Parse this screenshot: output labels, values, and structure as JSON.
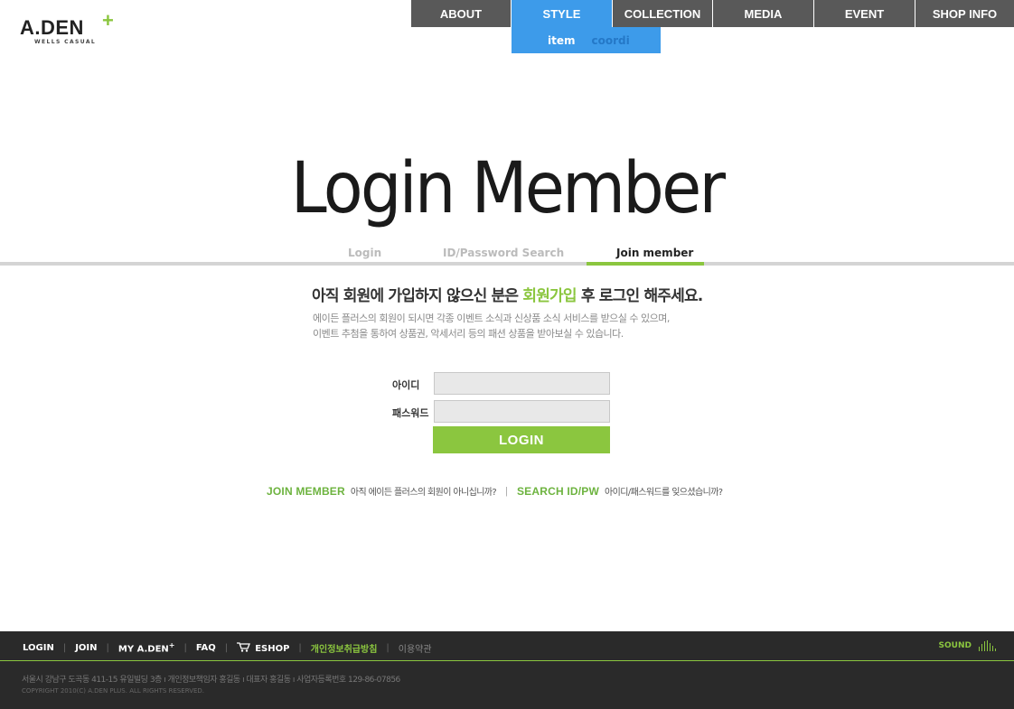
{
  "logo": {
    "main": "A.DEN",
    "plus": "+",
    "sub": "WELLS CASUAL"
  },
  "nav": {
    "items": [
      {
        "label": "ABOUT",
        "active": false
      },
      {
        "label": "STYLE",
        "active": true
      },
      {
        "label": "COLLECTION",
        "active": false
      },
      {
        "label": "MEDIA",
        "active": false
      },
      {
        "label": "EVENT",
        "active": false
      },
      {
        "label": "SHOP INFO",
        "active": false
      }
    ],
    "sub_items": [
      {
        "label": "item",
        "active": true
      },
      {
        "label": "coordi",
        "active": false
      }
    ]
  },
  "page_title": "Login Member",
  "tabs": [
    {
      "label": "Login",
      "active": false
    },
    {
      "label": "ID/Password Search",
      "active": false
    },
    {
      "label": "Join member",
      "active": true
    }
  ],
  "intro": {
    "heading_pre": "아직 회원에 가입하지 않으신 분은 ",
    "heading_highlight": "회원가입",
    "heading_post": " 후 로그인 해주세요.",
    "desc_line1": "에이든 플러스의 회원이 되시면 각종 이벤트 소식과 신상품 소식 서비스를 받으실 수 있으며,",
    "desc_line2": "이벤트 추첨을 통하여 상품권, 악세서리 등의 패션 상품을 받아보실 수 있습니다."
  },
  "form": {
    "id_label": "아이디",
    "id_value": "",
    "pw_label": "패스워드",
    "pw_value": "",
    "login_button": "LOGIN"
  },
  "links": {
    "join_label": "JOIN MEMBER",
    "join_desc": "아직 에이든 플러스의 회원이 아니십니까?",
    "search_label": "SEARCH ID/PW",
    "search_desc": "아이디/패스워드를 잊으셨습니까?"
  },
  "footer": {
    "menu": {
      "login": "LOGIN",
      "join": "JOIN",
      "my": "MY A.DEN",
      "my_plus": "+",
      "faq": "FAQ",
      "eshop": "ESHOP",
      "privacy": "개인정보취급방침",
      "terms": "이용약관"
    },
    "sound_label": "SOUND",
    "address": "서울시 강남구 도곡동 411-15 유일빌딩 3층  ı  개인정보책임자 홍길동  ı  대표자 홍길동  ı  사업자등록번호 129-86-07856",
    "copyright": "COPYRIGHT 2010(C) A.DEN PLUS. ALL RIGHTS RESERVED."
  },
  "icons": {
    "cart": "cart-icon",
    "sound": "sound-bars-icon"
  },
  "colors": {
    "accent_green": "#8bc63f",
    "nav_gray": "#595959",
    "nav_active_blue": "#3d9bea",
    "footer_bg": "#2a2a2a"
  }
}
